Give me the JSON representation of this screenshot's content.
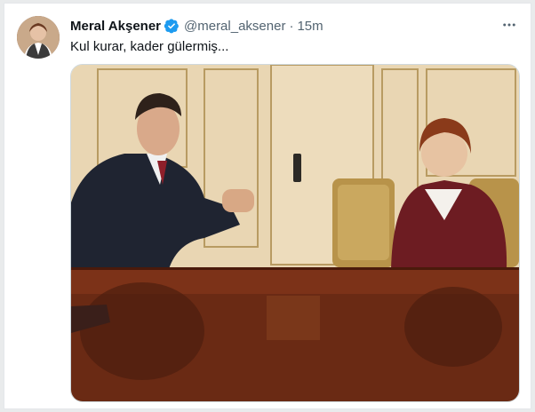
{
  "tweet": {
    "author_name": "Meral Akşener",
    "handle": "@meral_aksener",
    "separator": "·",
    "time": "15m",
    "text": "Kul kurar, kader gülermiş..."
  },
  "icons": {
    "verified": "verified-badge-icon",
    "more": "more-options-icon"
  },
  "colors": {
    "verified_blue": "#1d9bf0",
    "text_primary": "#0f1419",
    "text_secondary": "#536471"
  }
}
